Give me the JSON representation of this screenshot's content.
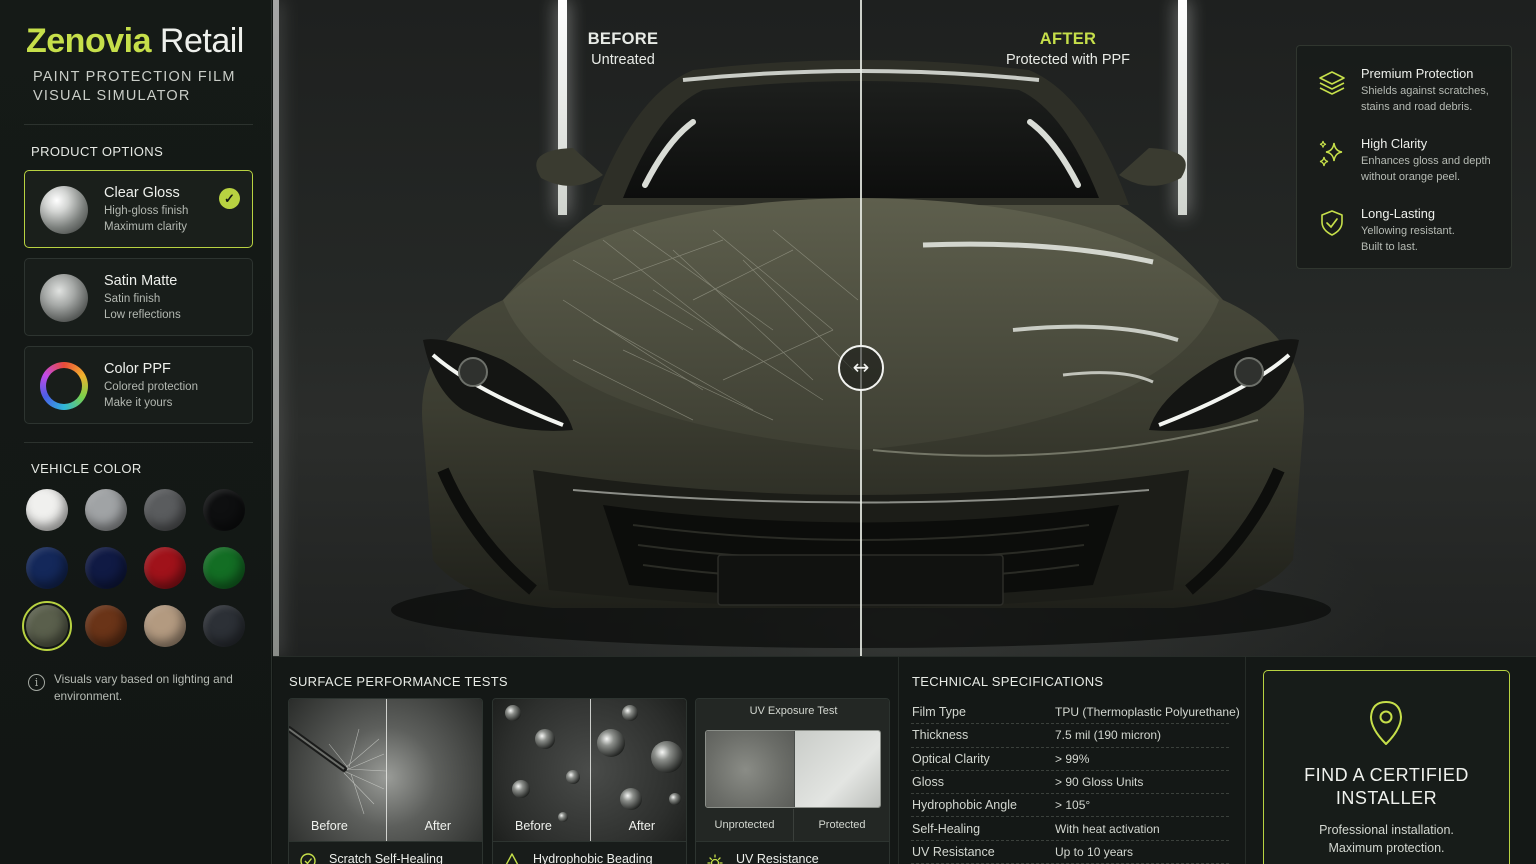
{
  "brand": {
    "name_accent": "Zenovia",
    "name_rest": " Retail",
    "tagline_1": "PAINT PROTECTION FILM",
    "tagline_2": "VISUAL SIMULATOR"
  },
  "product_options": {
    "title": "PRODUCT OPTIONS",
    "items": [
      {
        "title": "Clear Gloss",
        "line1": "High-gloss finish",
        "line2": "Maximum clarity",
        "selected": true,
        "icon": "gloss-swatch"
      },
      {
        "title": "Satin Matte",
        "line1": "Satin finish",
        "line2": "Low reflections",
        "selected": false,
        "icon": "satin-swatch"
      },
      {
        "title": "Color PPF",
        "line1": "Colored protection",
        "line2": "Make it yours",
        "selected": false,
        "icon": "color-ring-swatch"
      }
    ]
  },
  "vehicle_color": {
    "title": "VEHICLE COLOR",
    "swatches": [
      "#f0f0ee",
      "#a0a3a5",
      "#5a5c5e",
      "#0e0f10",
      "#14285a",
      "#101a44",
      "#a0121a",
      "#136e24",
      "#5a5f4c",
      "#6a3418",
      "#b39a80",
      "#2c3036"
    ],
    "selected_index": 8
  },
  "note": {
    "text": "Visuals vary based on lighting and environment."
  },
  "comparison": {
    "before_title": "BEFORE",
    "before_sub": "Untreated",
    "after_title": "AFTER",
    "after_sub": "Protected with PPF",
    "accent": "#c6df4a"
  },
  "features": [
    {
      "icon": "layers-icon",
      "title": "Premium Protection",
      "line1": "Shields against scratches,",
      "line2": "stains and road debris."
    },
    {
      "icon": "sparkle-icon",
      "title": "High Clarity",
      "line1": "Enhances gloss and depth",
      "line2": "without orange peel."
    },
    {
      "icon": "shield-check-icon",
      "title": "Long-Lasting",
      "line1": "Yellowing resistant.",
      "line2": "Built to last."
    }
  ],
  "tests": {
    "title": "SURFACE PERFORMANCE TESTS",
    "cards": [
      {
        "name": "Scratch Self-Healing",
        "left": "Before",
        "right": "After",
        "icon": "scratch-icon"
      },
      {
        "name": "Hydrophobic Beading",
        "left": "Before",
        "right": "After",
        "icon": "drop-icon"
      },
      {
        "name": "UV Resistance",
        "header": "UV Exposure Test",
        "left": "Unprotected",
        "right": "Protected",
        "icon": "sun-icon"
      }
    ]
  },
  "specs": {
    "title": "TECHNICAL SPECIFICATIONS",
    "rows": [
      {
        "k": "Film Type",
        "v": "TPU (Thermoplastic Polyurethane)"
      },
      {
        "k": "Thickness",
        "v": "7.5 mil (190 micron)"
      },
      {
        "k": "Optical Clarity",
        "v": "> 99%"
      },
      {
        "k": "Gloss",
        "v": "> 90 Gloss Units"
      },
      {
        "k": "Hydrophobic Angle",
        "v": "> 105°"
      },
      {
        "k": "Self-Healing",
        "v": "With heat activation"
      },
      {
        "k": "UV Resistance",
        "v": "Up to 10 years"
      }
    ]
  },
  "installer": {
    "title_1": "FIND A CERTIFIED",
    "title_2": "INSTALLER",
    "sub_1": "Professional installation.",
    "sub_2": "Maximum protection."
  }
}
